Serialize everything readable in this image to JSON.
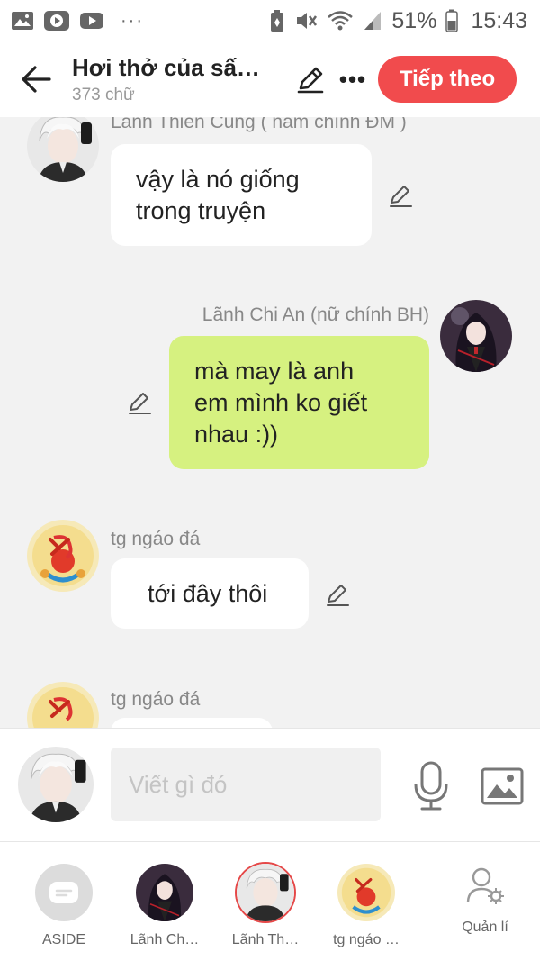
{
  "status_bar": {
    "battery": "51%",
    "time": "15:43",
    "overflow": "···",
    "icons": [
      "gallery-icon",
      "video-icon",
      "youtube-icon",
      "battery-saver-icon",
      "mute-icon",
      "wifi-icon",
      "signal-icon",
      "battery-icon"
    ]
  },
  "header": {
    "title": "Hơi thở của sấ…",
    "word_count": "373 chữ",
    "next_label": "Tiếp theo",
    "more_label": "•••",
    "accent_color": "#f14b4d"
  },
  "messages": [
    {
      "sender": "Lãnh Thiên Cung ( nam chính ĐM )",
      "text": "vậy là nó giống\ntrong truyện",
      "side": "left",
      "avatar": "white-hair-boy"
    },
    {
      "sender": "Lãnh Chi An (nữ chính BH)",
      "text": "mà may là anh\nem mình ko giết\nnhau :))",
      "side": "right",
      "avatar": "dark-hair-girl"
    },
    {
      "sender": "tg ngáo đá",
      "text": "tới đây thôi",
      "side": "left",
      "avatar": "hammer-sickle"
    },
    {
      "sender": "tg ngáo đá",
      "text": "",
      "side": "left",
      "avatar": "hammer-sickle"
    }
  ],
  "input": {
    "placeholder": "Viết gì đó"
  },
  "characters": [
    {
      "label": "ASIDE",
      "kind": "aside"
    },
    {
      "label": "Lãnh Ch…",
      "kind": "dark-hair-girl"
    },
    {
      "label": "Lãnh Th…",
      "kind": "white-hair-boy"
    },
    {
      "label": "tg ngáo …",
      "kind": "hammer-sickle"
    },
    {
      "label": "Quản lí",
      "kind": "manage"
    }
  ],
  "colors": {
    "bubble_right": "#d6f180",
    "bubble_left": "#ffffff",
    "background": "#f2f2f2"
  }
}
